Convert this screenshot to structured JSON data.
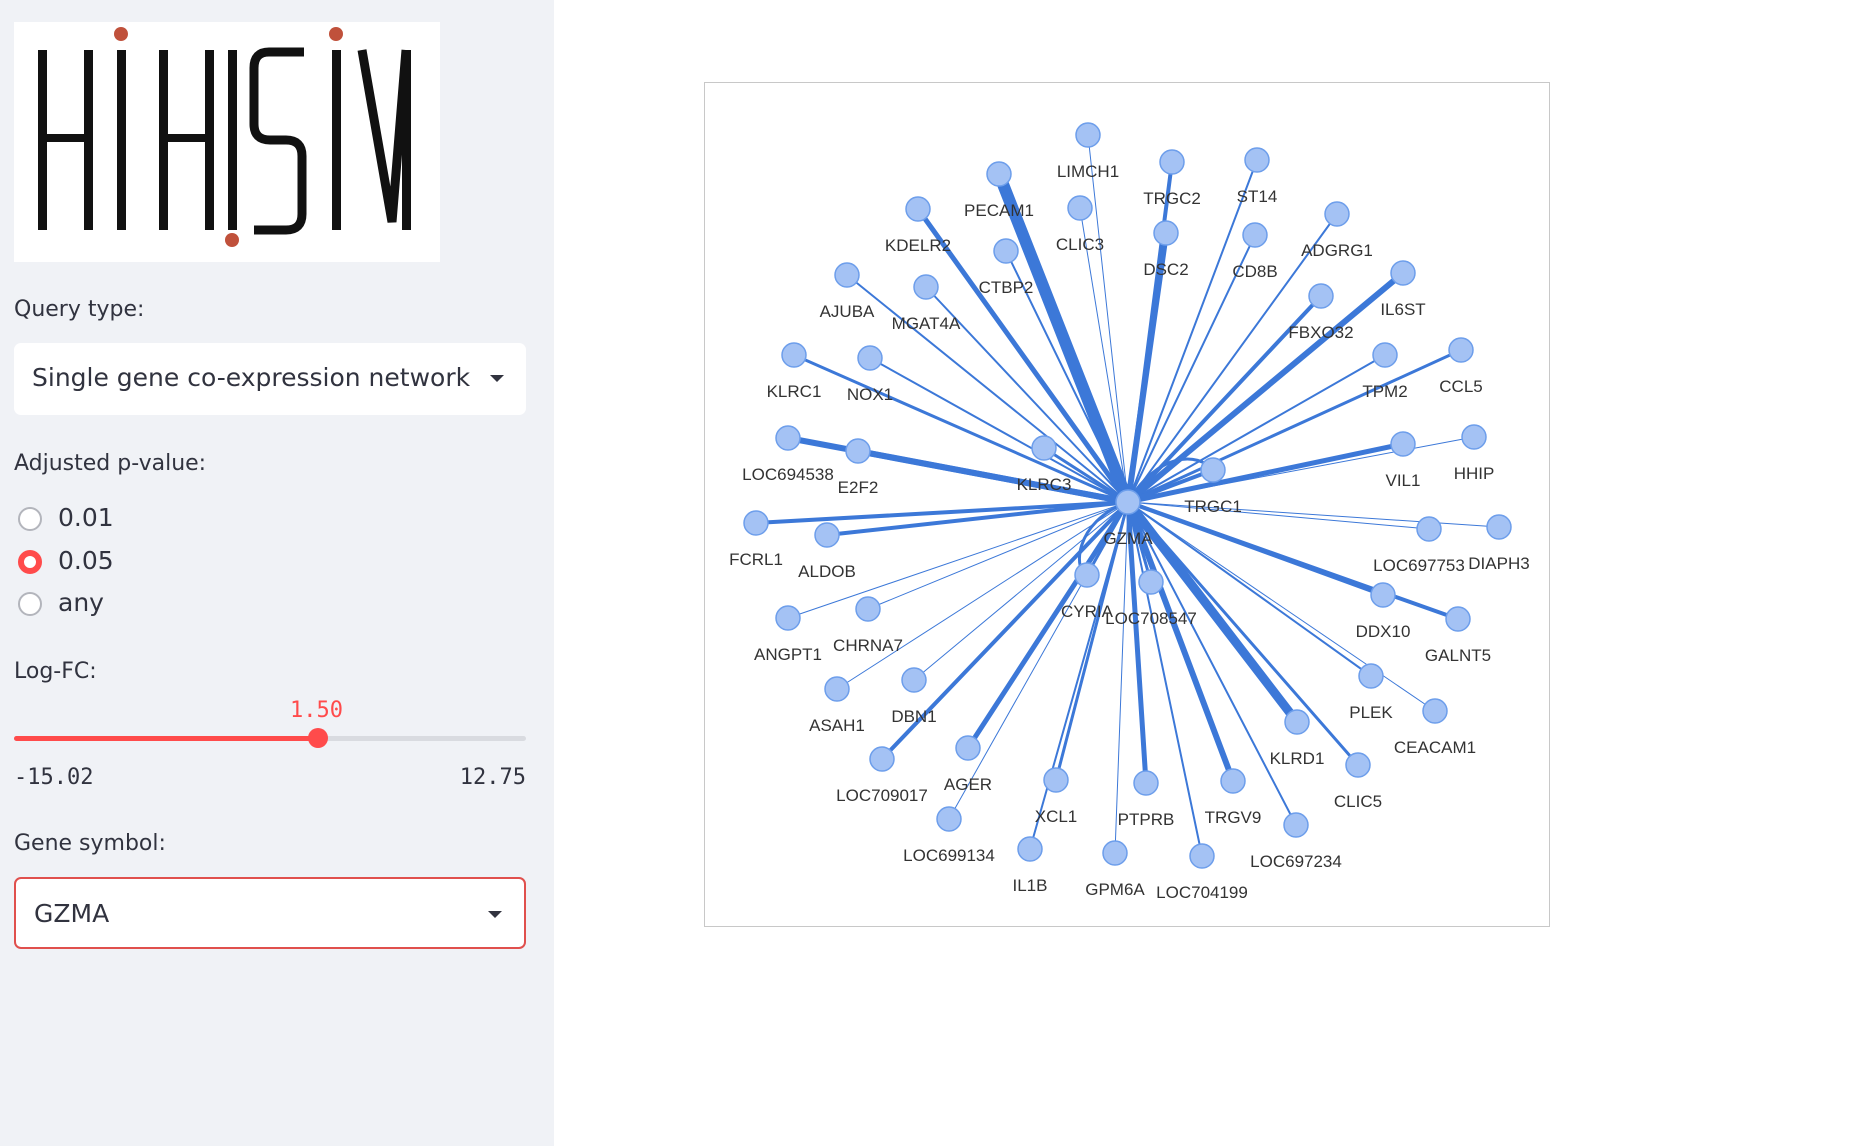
{
  "logo": {
    "text": "HIHISIV"
  },
  "query_type": {
    "label": "Query type:",
    "value": "Single gene co-expression network"
  },
  "pvalue": {
    "label": "Adjusted p-value:",
    "options": [
      "0.01",
      "0.05",
      "any"
    ],
    "selected": "0.05"
  },
  "logfc": {
    "label": "Log-FC:",
    "value": "1.50",
    "min": "-15.02",
    "max": "12.75",
    "fraction": 0.594
  },
  "gene_symbol": {
    "label": "Gene symbol:",
    "value": "GZMA"
  },
  "network": {
    "center": "GZMA",
    "node_color": "#a4c2f4",
    "edge_color": "#3c78d8",
    "nodes": [
      "LIMCH1",
      "TRGC2",
      "ST14",
      "PECAM1",
      "KDELR2",
      "CLIC3",
      "DSC2",
      "CD8B",
      "ADGRG1",
      "CTBP2",
      "AJUBA",
      "MGAT4A",
      "IL6ST",
      "FBXO32",
      "KLRC1",
      "NOX1",
      "TPM2",
      "CCL5",
      "LOC694538",
      "E2F2",
      "KLRC3",
      "VIL1",
      "HHIP",
      "TRGC1",
      "FCRL1",
      "ALDOB",
      "LOC697753",
      "DIAPH3",
      "CYRIA",
      "LOC708547",
      "ANGPT1",
      "CHRNA7",
      "DDX10",
      "GALNT5",
      "ASAH1",
      "DBN1",
      "PLEK",
      "CEACAM1",
      "LOC709017",
      "AGER",
      "KLRD1",
      "CLIC5",
      "XCL1",
      "PTPRB",
      "TRGV9",
      "LOC699134",
      "LOC697234",
      "IL1B",
      "GPM6A",
      "LOC704199"
    ]
  }
}
